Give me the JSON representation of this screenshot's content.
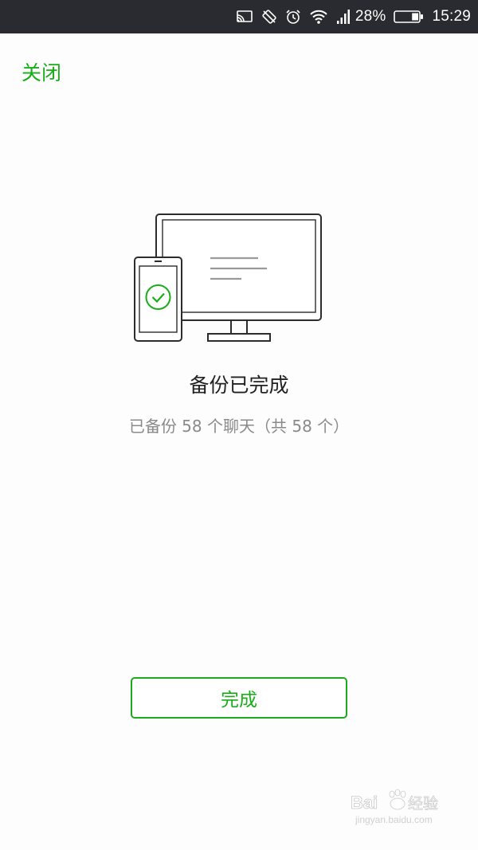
{
  "status_bar": {
    "battery_percent": "28%",
    "battery_level": 0.28,
    "time": "15:29",
    "icons": [
      "cast-icon",
      "no-signal-rotate-icon",
      "alarm-icon",
      "wifi-icon",
      "cellular-signal-icon",
      "battery-icon"
    ]
  },
  "header": {
    "close_label": "关闭"
  },
  "main": {
    "title": "备份已完成",
    "subtitle": "已备份 58 个聊天（共 58 个）",
    "illustration_icons": [
      "monitor-icon",
      "phone-icon",
      "checkmark-icon"
    ]
  },
  "footer": {
    "done_label": "完成"
  },
  "colors": {
    "accent": "#1aad19",
    "status_bar_bg": "#2a2b30",
    "title_text": "#222222",
    "subtitle_text": "#8a8a8a"
  },
  "watermark": {
    "brand": "Bai",
    "brand_suffix": "经验",
    "url": "jingyan.baidu.com"
  }
}
